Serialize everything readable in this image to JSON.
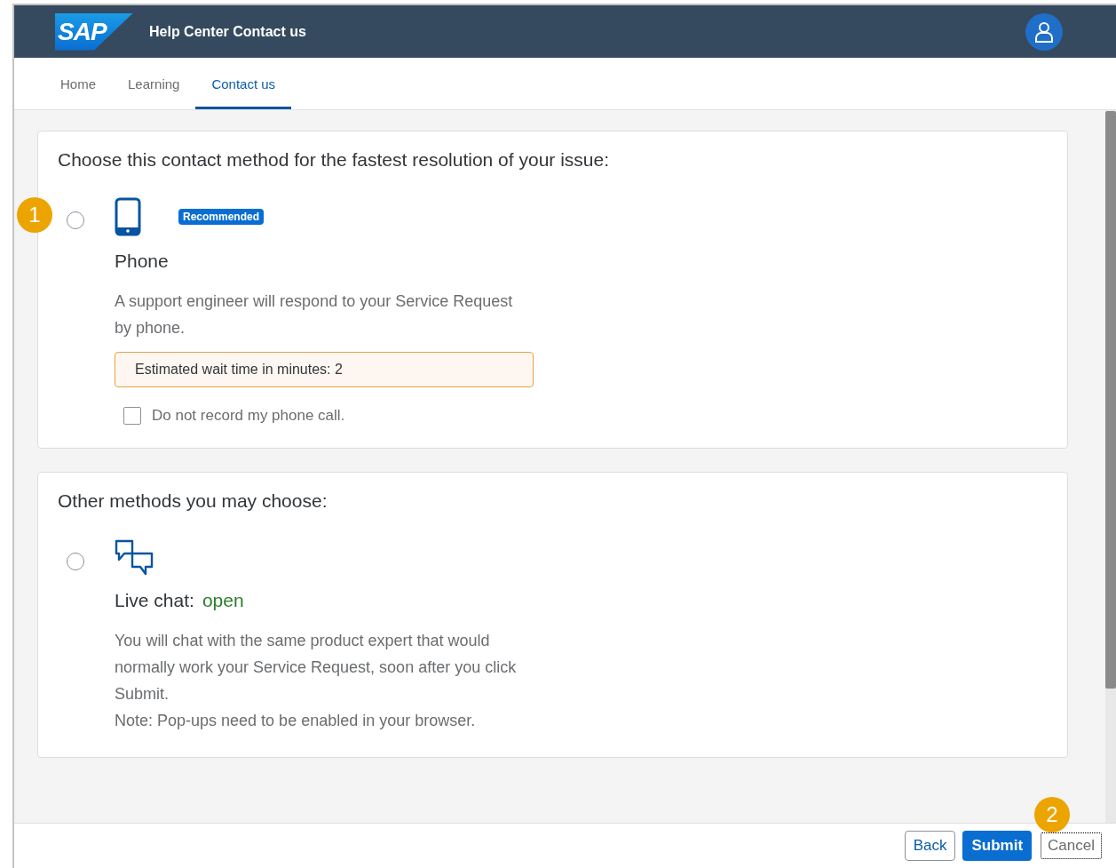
{
  "header": {
    "logo": "SAP",
    "title": "Help Center Contact us"
  },
  "tabs": [
    {
      "label": "Home",
      "selected": false
    },
    {
      "label": "Learning",
      "selected": false
    },
    {
      "label": "Contact us",
      "selected": true
    }
  ],
  "sections": [
    {
      "heading": "Choose this contact method for the fastest resolution of your issue:",
      "options": [
        {
          "kind": "phone",
          "selected": false,
          "title": "Phone",
          "badge": "Recommended",
          "description": [
            "A support engineer will respond to your Service Request by phone."
          ],
          "notice": "Estimated wait time in minutes: 2",
          "checkbox": {
            "label": "Do not record my phone call.",
            "checked": false
          }
        }
      ]
    },
    {
      "heading": "Other methods you may choose:",
      "options": [
        {
          "kind": "chat",
          "selected": false,
          "title": "Live chat:",
          "status": "open",
          "description": [
            "You will chat with the same product expert that would normally work your Service Request, soon after you click Submit.",
            "Note: Pop-ups need to be enabled in your browser."
          ]
        }
      ]
    }
  ],
  "buttons": [
    {
      "label": "Back",
      "kind": "default",
      "focused": false
    },
    {
      "label": "Submit",
      "kind": "emphasized",
      "focused": false
    },
    {
      "label": "Cancel",
      "kind": "transparent",
      "focused": true
    }
  ],
  "callouts": [
    "1",
    "2"
  ]
}
